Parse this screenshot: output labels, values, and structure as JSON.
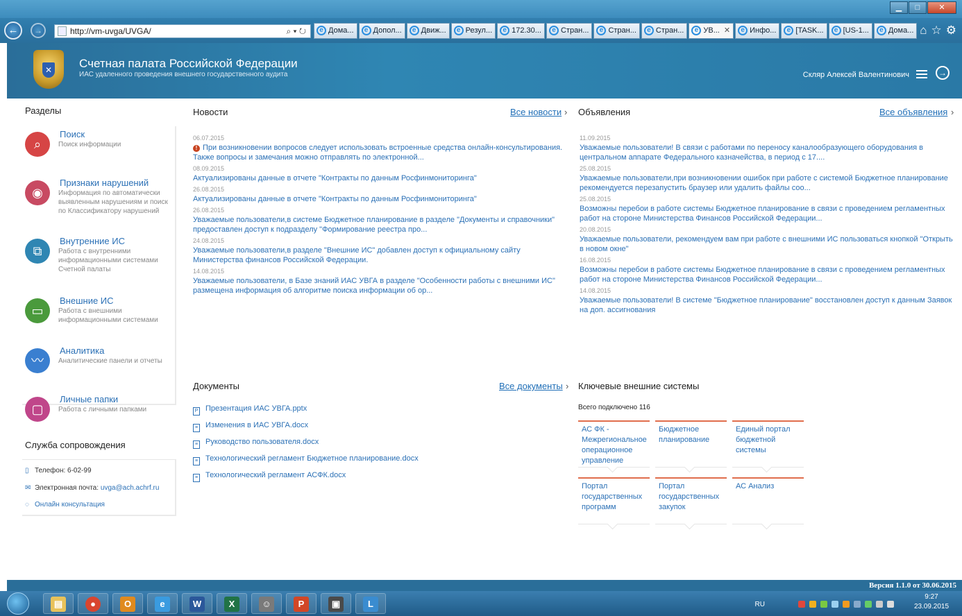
{
  "browser": {
    "url": "http://vm-uvga/UVGA/",
    "tabs": [
      "Дома...",
      "Допол...",
      "Движ...",
      "Резул...",
      "172.30...",
      "Стран...",
      "Стран...",
      "Стран...",
      "УВ...",
      "Инфо...",
      "[TASK...",
      "[US-1...",
      "Дома..."
    ],
    "active_tab": 8
  },
  "header": {
    "title": "Счетная палата Российской Федерации",
    "subtitle": "ИАС удаленного проведения внешнего государственного аудита",
    "user": "Скляр Алексей Валентинович"
  },
  "sidebar": {
    "title": "Разделы",
    "items": [
      {
        "title": "Поиск",
        "desc": "Поиск информации",
        "color": "#d64545"
      },
      {
        "title": "Признаки нарушений",
        "desc": "Информация по автоматически выявленным нарушениям и поиск по Классификатору нарушений",
        "color": "#c84a62"
      },
      {
        "title": "Внутренние ИС",
        "desc": "Работа с внутренними информационными системами Счетной палаты",
        "color": "#2f86b3"
      },
      {
        "title": "Внешние ИС",
        "desc": "Работа с внешними информационными системами",
        "color": "#4a9a3c"
      },
      {
        "title": "Аналитика",
        "desc": "Аналитические панели и отчеты",
        "color": "#3a7fd0"
      },
      {
        "title": "Личные папки",
        "desc": "Работа с личными папками",
        "color": "#c0468a"
      }
    ]
  },
  "support": {
    "title": "Служба сопровождения",
    "phone": "Телефон: 6-02-99",
    "email_label": "Электронная почта:",
    "email": "uvga@ach.achrf.ru",
    "online": "Онлайн консультация"
  },
  "news": {
    "title": "Новости",
    "all_link": "Все новости",
    "items": [
      {
        "date": "06.07.2015",
        "text": "При возникновении вопросов следует использовать встроенные средства онлайн-консультирования. Также вопросы и замечания можно отправлять по электронной..."
      },
      {
        "date": "08.09.2015",
        "text": "Актуализированы данные в отчете \"Контракты по данным Росфинмониторинга\""
      },
      {
        "date": "26.08.2015",
        "text": "Актуализированы данные в отчете \"Контракты по данным Росфинмониторинга\""
      },
      {
        "date": "26.08.2015",
        "text": "Уважаемые пользователи,в системе Бюджетное планирование в разделе \"Документы и справочники\" предоставлен доступ к подразделу \"Формирование реестра про..."
      },
      {
        "date": "24.08.2015",
        "text": "Уважаемые пользователи,в разделе \"Внешние ИС\" добавлен доступ к официальному сайту Министерства финансов Российской Федерации."
      },
      {
        "date": "14.08.2015",
        "text": "Уважаемые пользователи, в Базе знаний ИАС УВГА в разделе \"Особенности работы с внешними ИС\" размещена информация об алгоритме поиска информации об ор..."
      }
    ]
  },
  "announcements": {
    "title": "Объявления",
    "all_link": "Все объявления",
    "items": [
      {
        "date": "11.09.2015",
        "text": "Уважаемые пользователи! В связи с работами по переносу каналообразующего оборудования в центральном аппарате Федерального казначейства, в период с 17...."
      },
      {
        "date": "25.08.2015",
        "text": "Уважаемые пользователи,при возникновении ошибок при работе с системой Бюджетное планирование рекомендуется перезапустить браузер или удалить файлы соо..."
      },
      {
        "date": "25.08.2015",
        "text": "Возможны перебои в работе системы Бюджетное планирование в связи с проведением регламентных работ на стороне Министерства Финансов Российской Федерации..."
      },
      {
        "date": "20.08.2015",
        "text": "Уважаемые пользователи, рекомендуем вам при работе с внешними ИС пользоваться кнопкой \"Открыть в новом окне\""
      },
      {
        "date": "16.08.2015",
        "text": "Возможны перебои в работе системы Бюджетное планирование в связи с проведением регламентных работ на стороне Министерства Финансов Российской Федерации..."
      },
      {
        "date": "14.08.2015",
        "text": "Уважаемые пользователи! В системе \"Бюджетное планирование\" восстановлен доступ к данным Заявок на доп. ассигнования"
      }
    ]
  },
  "documents": {
    "title": "Документы",
    "all_link": "Все документы",
    "items": [
      "Презентация ИАС УВГА.pptx",
      "Изменения в ИАС УВГА.docx",
      "Руководство пользователя.docx",
      "Технологический регламент Бюджетное планирование.docx",
      "Технологический регламент АСФК.docx"
    ]
  },
  "systems": {
    "title": "Ключевые внешние системы",
    "total": "Всего подключено 116",
    "items": [
      "АС ФК - Межрегиональное операционное управление",
      "Бюджетное планирование",
      "Единый портал бюджетной системы",
      "Портал государственных программ",
      "Портал государственных закупок",
      "АС Анализ"
    ]
  },
  "footer": {
    "version": "Версия 1.1.0 от 30.06.2015"
  },
  "taskbar": {
    "lang": "RU",
    "time": "9:27",
    "date": "23.09.2015"
  }
}
